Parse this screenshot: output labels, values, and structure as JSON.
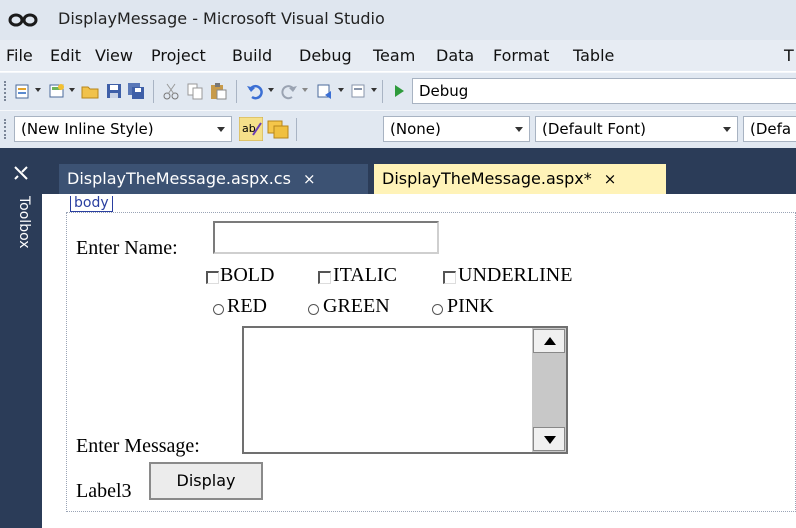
{
  "window": {
    "title": "DisplayMessage - Microsoft Visual Studio"
  },
  "menu": {
    "items": [
      "File",
      "Edit",
      "View",
      "Project",
      "Build",
      "Debug",
      "Team",
      "Data",
      "Format",
      "Table",
      "T"
    ]
  },
  "toolbar1": {
    "config_value": "Debug"
  },
  "toolbar2": {
    "style_value": "(New Inline Style)",
    "target_value": "(None)",
    "font_value": "(Default Font)",
    "size_value": "(Defa"
  },
  "toolbox": {
    "label": "Toolbox"
  },
  "tabs": [
    {
      "label": "DisplayTheMessage.aspx.cs",
      "close": "×"
    },
    {
      "label": "DisplayTheMessage.aspx*",
      "close": "×"
    }
  ],
  "design": {
    "body_tag": "body",
    "name_label": "Enter Name:",
    "checkboxes": [
      "BOLD",
      "ITALIC",
      "UNDERLINE"
    ],
    "radios": [
      "RED",
      "GREEN",
      "PINK"
    ],
    "message_label": "Enter Message:",
    "output_label": "Label3",
    "display_button": "Display"
  },
  "colors": {
    "accent_dark": "#2b3c58",
    "active_tab": "#fff3b8",
    "tag_blue": "#2a3fa0"
  },
  "icons": [
    "infinity-logo-icon",
    "new-project-icon",
    "add-item-icon",
    "open-folder-icon",
    "save-icon",
    "save-all-icon",
    "cut-icon",
    "copy-icon",
    "paste-icon",
    "undo-icon",
    "redo-icon",
    "navigate-icon",
    "find-icon",
    "start-debug-icon",
    "foreground-color-icon",
    "background-color-icon",
    "pin-icon"
  ]
}
